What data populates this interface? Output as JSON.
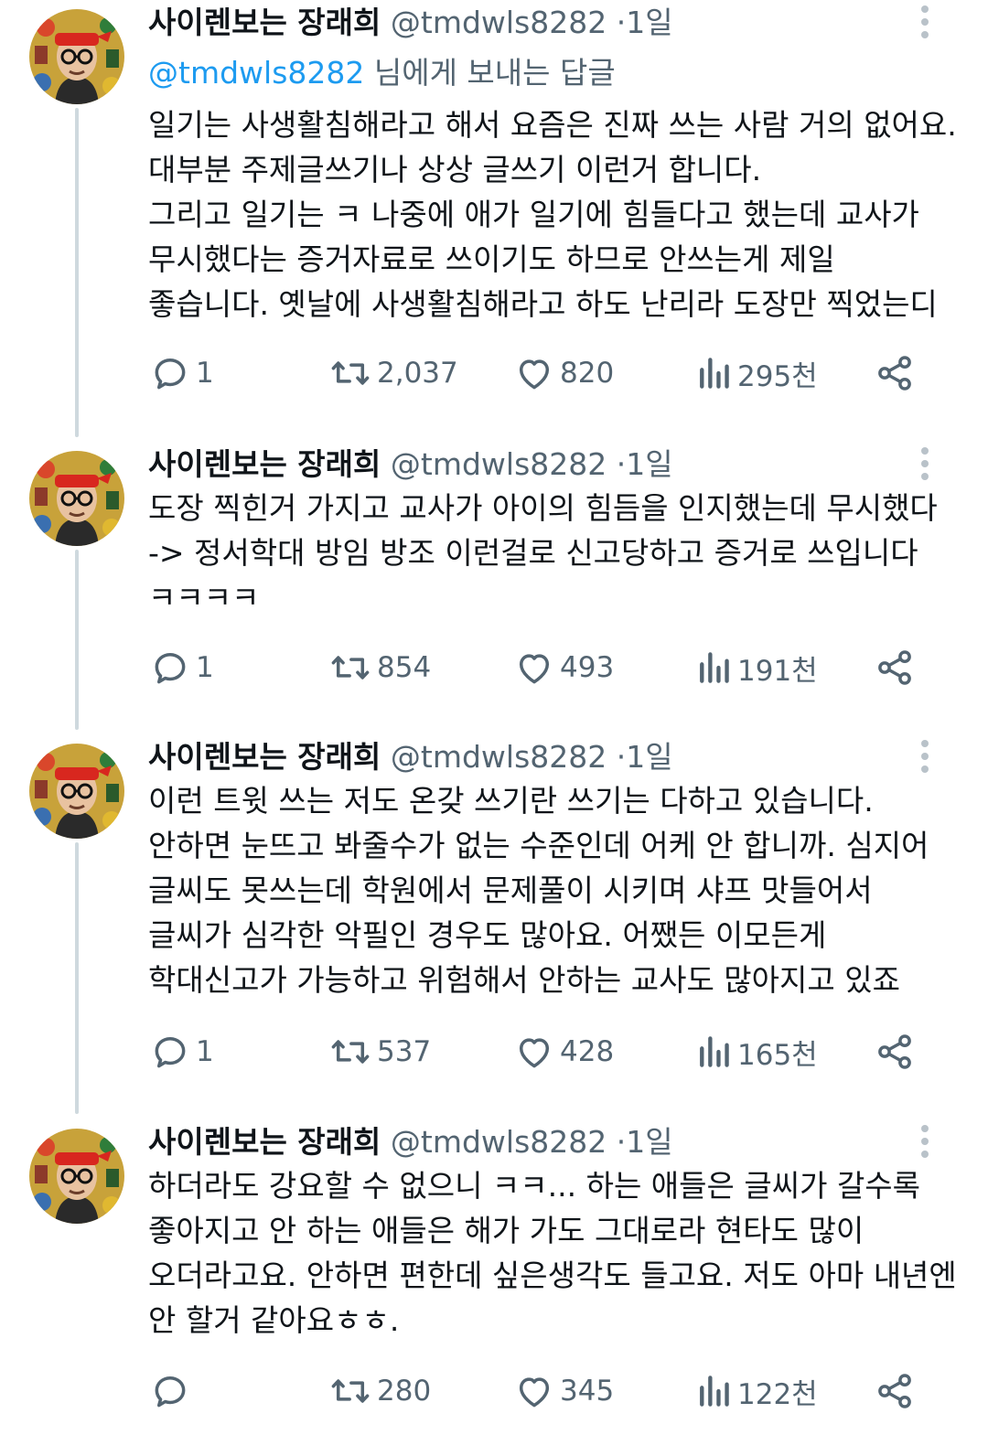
{
  "author": {
    "name": "사이렌보는 장래희",
    "handle": "@tmdwls8282",
    "separator": "·"
  },
  "tweets": [
    {
      "time": "1일",
      "reply_prefix": "@tmdwls8282",
      "reply_suffix": " 님에게 보내는 답글",
      "lines": [
        "일기는 사생활침해라고 해서 요즘은 진짜 쓰는 사람 거의 없어요.",
        "대부분 주제글쓰기나 상상 글쓰기 이런거 합니다.",
        "그리고 일기는 ㅋ 나중에 애가 일기에 힘들다고 했는데 교사가",
        "무시했다는 증거자료로 쓰이기도 하므로 안쓰는게 제일",
        "좋습니다. 옛날에 사생활침해라고 하도 난리라 도장만 찍었는디"
      ],
      "stats": {
        "replies": "1",
        "retweets": "2,037",
        "likes": "820",
        "views": "295천"
      }
    },
    {
      "time": "1일",
      "lines": [
        "도장 찍힌거 가지고 교사가 아이의 힘듬을 인지했는데 무시했다",
        "-> 정서학대 방임 방조 이런걸로 신고당하고 증거로 쓰입니다",
        "ㅋㅋㅋㅋ"
      ],
      "stats": {
        "replies": "1",
        "retweets": "854",
        "likes": "493",
        "views": "191천"
      }
    },
    {
      "time": "1일",
      "lines": [
        "이런 트윗 쓰는 저도 온갖 쓰기란 쓰기는 다하고 있습니다.",
        "안하면 눈뜨고 봐줄수가 없는 수준인데 어케 안 합니까. 심지어",
        "글씨도 못쓰는데 학원에서 문제풀이 시키며 샤프 맛들어서",
        "글씨가 심각한 악필인 경우도 많아요. 어쨌든 이모든게",
        "학대신고가 가능하고 위험해서 안하는 교사도 많아지고 있죠"
      ],
      "stats": {
        "replies": "1",
        "retweets": "537",
        "likes": "428",
        "views": "165천"
      }
    },
    {
      "time": "1일",
      "lines": [
        "하더라도 강요할 수 없으니 ㅋㅋ... 하는 애들은 글씨가 갈수록",
        "좋아지고 안 하는 애들은 해가 가도 그대로라 현타도 많이",
        "오더라고요. 안하면 편한데 싶은생각도 들고요. 저도 아마 내년엔",
        "안 할거 같아요ㅎㅎ."
      ],
      "stats": {
        "replies": "",
        "retweets": "280",
        "likes": "345",
        "views": "122천"
      }
    }
  ],
  "icons": {
    "reply": "reply-icon",
    "retweet": "retweet-icon",
    "like": "heart-icon",
    "views": "views-icon",
    "share": "share-icon",
    "more": "more-vertical-icon"
  },
  "colors": {
    "text": "#0f1419",
    "secondary": "#536471",
    "mention": "#1d9bf0",
    "thread_line": "#cfd9de"
  }
}
